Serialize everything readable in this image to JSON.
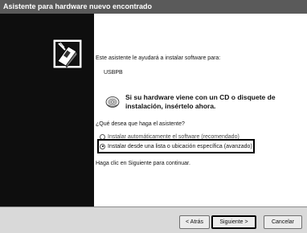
{
  "window": {
    "title": "Asistente para hardware nuevo encontrado"
  },
  "content": {
    "intro": "Este asistente le ayudará a instalar software para:",
    "device_name": "USBPB",
    "cd_prompt": "Si su hardware viene con un CD o disquete de instalación, insértelo ahora.",
    "question": "¿Qué desea que haga el asistente?",
    "options": [
      {
        "label": "Instalar automáticamente el software (recomendado)",
        "selected": false
      },
      {
        "label": "Instalar desde una lista o ubicación específica (avanzado)",
        "selected": true
      }
    ],
    "continue_hint": "Haga clic en Siguiente para continuar."
  },
  "buttons": {
    "back_label": "< Atrás",
    "next_label": "Siguiente >",
    "cancel_label": "Cancelar"
  },
  "icons": {
    "wizard": "hardware-wizard-icon",
    "cd": "cd-icon"
  },
  "colors": {
    "titlebar": "#5a5a5a",
    "left_panel": "#0e0e0e",
    "footer": "#d9d9d9"
  }
}
